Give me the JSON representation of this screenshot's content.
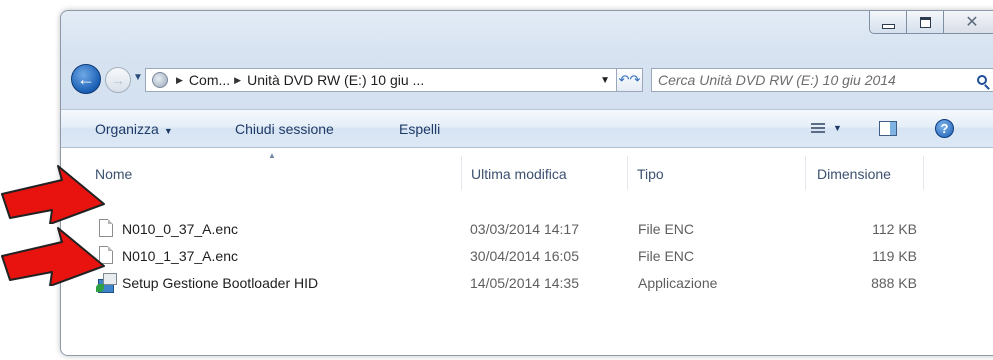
{
  "window": {
    "controls": {
      "minimize": "minimize",
      "maximize": "maximize",
      "close": "close"
    }
  },
  "nav": {
    "breadcrumbs": [
      "Com...",
      "Unità DVD RW (E:) 10 giu ..."
    ],
    "search_placeholder": "Cerca Unità DVD RW (E:) 10 giu 2014"
  },
  "toolbar": {
    "organize_label": "Organizza",
    "close_session_label": "Chiudi sessione",
    "eject_label": "Espelli"
  },
  "columns": {
    "name": "Nome",
    "modified": "Ultima modifica",
    "type": "Tipo",
    "size": "Dimensione"
  },
  "files": [
    {
      "name": "N010_0_37_A.enc",
      "modified": "03/03/2014 14:17",
      "type": "File ENC",
      "size": "112 KB",
      "icon": "document-icon"
    },
    {
      "name": "N010_1_37_A.enc",
      "modified": "30/04/2014 16:05",
      "type": "File ENC",
      "size": "119 KB",
      "icon": "document-icon"
    },
    {
      "name": "Setup Gestione Bootloader HID",
      "modified": "14/05/2014 14:35",
      "type": "Applicazione",
      "size": "888 KB",
      "icon": "setup-installer-icon"
    }
  ],
  "colors": {
    "arrow_red": "#e8130f",
    "window_frame": "#d7e3f1",
    "command_bar_text": "#1e3a66"
  }
}
